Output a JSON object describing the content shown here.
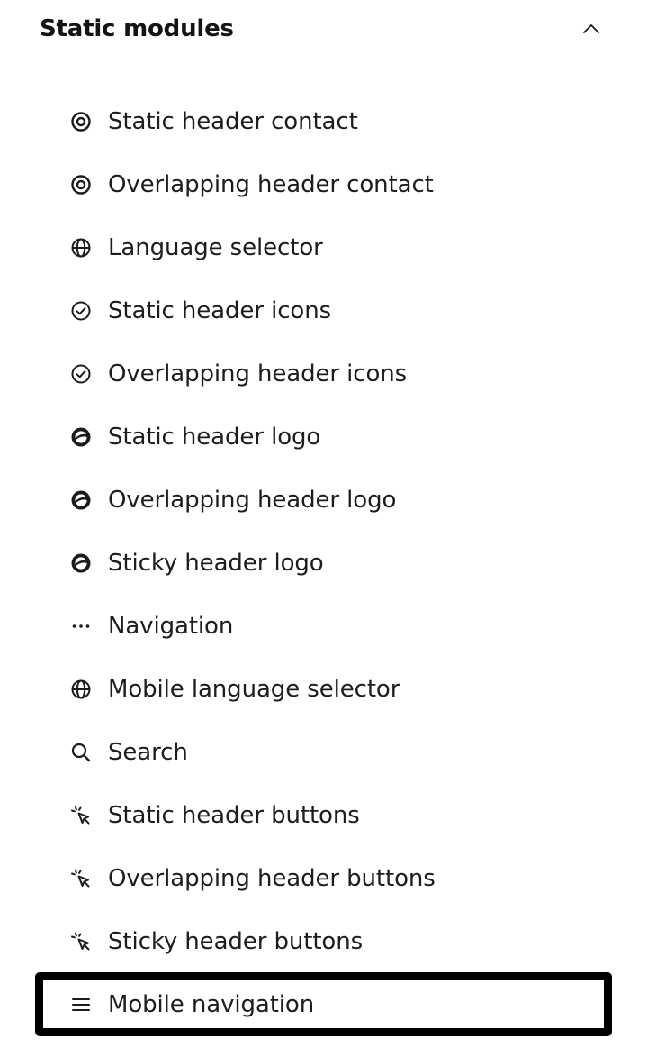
{
  "section": {
    "title": "Static modules",
    "collapse_icon": "chevron-up-icon"
  },
  "modules": [
    {
      "label": "Static header contact",
      "icon": "contact-target-icon"
    },
    {
      "label": "Overlapping header contact",
      "icon": "contact-target-icon"
    },
    {
      "label": "Language selector",
      "icon": "globe-icon"
    },
    {
      "label": "Static header icons",
      "icon": "check-circle-icon"
    },
    {
      "label": "Overlapping header icons",
      "icon": "check-circle-icon"
    },
    {
      "label": "Static header logo",
      "icon": "logo-icon"
    },
    {
      "label": "Overlapping header logo",
      "icon": "logo-icon"
    },
    {
      "label": "Sticky header logo",
      "icon": "logo-icon"
    },
    {
      "label": "Navigation",
      "icon": "ellipsis-icon"
    },
    {
      "label": "Mobile language selector",
      "icon": "globe-icon"
    },
    {
      "label": "Search",
      "icon": "search-icon"
    },
    {
      "label": "Static header buttons",
      "icon": "cursor-click-icon"
    },
    {
      "label": "Overlapping header buttons",
      "icon": "cursor-click-icon"
    },
    {
      "label": "Sticky header buttons",
      "icon": "cursor-click-icon"
    },
    {
      "label": "Mobile navigation",
      "icon": "hamburger-menu-icon",
      "selected": true
    }
  ],
  "colors": {
    "text": "#1d1d1d",
    "selection_border": "#000000",
    "background": "#ffffff"
  }
}
